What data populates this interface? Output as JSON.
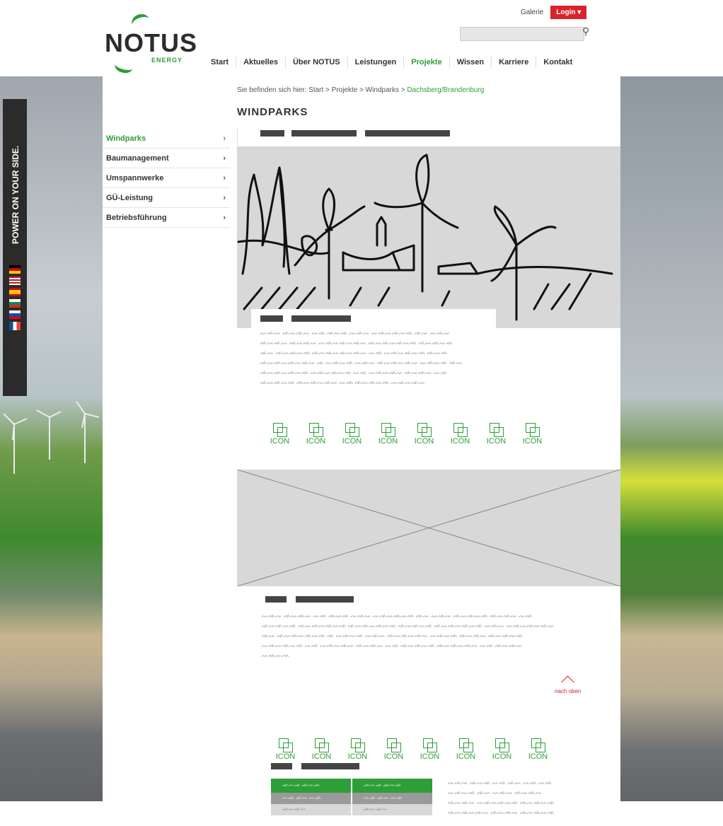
{
  "header": {
    "logo": {
      "word": "NOTUS",
      "sub": "ENERGY"
    },
    "top_links": {
      "galerie": "Galerie",
      "login": "Login ▾"
    },
    "search": {
      "placeholder": ""
    },
    "nav": [
      "Start",
      "Aktuelles",
      "Über NOTUS",
      "Leistungen",
      "Projekte",
      "Wissen",
      "Karriere",
      "Kontakt"
    ],
    "active_nav": "Projekte"
  },
  "sidebar_banner": {
    "text": "POWER ON YOUR SIDE."
  },
  "breadcrumb": {
    "prefix": "Sie befinden sich hier: Start > Projekte > Windparks > ",
    "current": "Dachsberg/Brandenburg"
  },
  "page_title": "WINDPARKS",
  "sidenav": [
    {
      "label": "Windparks",
      "active": true
    },
    {
      "label": "Baumanagement",
      "active": false
    },
    {
      "label": "Umspannwerke",
      "active": false
    },
    {
      "label": "GÜ-Leistung",
      "active": false
    },
    {
      "label": "Betriebsführung",
      "active": false
    }
  ],
  "section1": {
    "text_lines": [
      "ᨓᨒᨓ ᨒᨓᨒᨓ ᨓᨒ ᨒᨓᨒ ᨓᨒᨓ ᨓᨒᨓᨒᨓᨒ ᨒᨓ ᨓᨒᨓ",
      "ᨒᨓᨒᨓ ᨒᨓᨒᨓ ᨓᨒᨓᨒᨓᨒᨓ ᨒᨓᨒᨓᨒᨓᨒ ᨒᨓᨒᨓᨒ",
      "ᨒᨓ ᨒᨓᨒᨓᨒ ᨒᨓᨒᨓᨒᨓᨒᨓ ᨓᨒ ᨓᨒᨓᨒᨓᨒ ᨒᨓᨒ",
      "ᨒᨓᨒᨓᨒᨓᨒᨓ ᨒ ᨓᨒᨓᨒ ᨓᨒᨓ ᨒᨓᨒᨓᨒᨓ ᨓᨒᨓᨒ ᨒᨓ",
      "ᨒᨓᨒᨓᨒᨓᨒ ᨓᨒᨓᨒᨓᨒ ᨓᨒ ᨓᨒᨓᨒᨓ ᨒᨓᨒᨓ ᨓᨒ",
      "ᨒᨓᨒᨓᨒ ᨒᨓᨒᨓᨒᨓ ᨓᨒ ᨒᨓᨒᨓᨒ ᨓᨒᨓᨒᨓ"
    ]
  },
  "icons_row1": [
    "ICON",
    "ICON",
    "ICON",
    "ICON",
    "ICON",
    "ICON",
    "ICON",
    "ICON"
  ],
  "section2": {
    "text_lines": [
      "ᨓᨒᨓ ᨒᨓᨒᨓ ᨓᨒ ᨒᨓᨒ ᨓᨒᨓ ᨓᨒᨓᨒᨓᨒ ᨒᨓ ᨓᨒᨓ ᨒᨓᨒᨓᨒ ᨒᨓᨒᨓ ᨓᨒ",
      "ᨒᨓᨒᨓᨒ ᨒᨓᨒᨓᨒᨓᨒ ᨒᨓᨒᨓᨒᨓᨒ ᨒᨓᨒᨓᨒ ᨒᨓᨒᨓᨒᨓᨒ ᨓᨒᨓ ᨓᨒᨓᨒᨓᨒᨓ",
      "ᨒᨓ ᨒᨓᨒᨓᨒᨓᨒ ᨒ ᨓᨒᨓᨒ ᨓᨒᨓ ᨒᨓᨒᨓᨒᨓ ᨓᨒᨓᨒ ᨒᨓᨒᨓ ᨒᨓᨒᨓᨒ",
      "ᨓᨒᨓᨒᨓᨒ ᨓᨒ ᨓᨒᨓᨒᨓ ᨒᨓᨒᨓ ᨓᨒ ᨒᨓᨒᨓᨒ ᨒᨓᨒᨓᨒᨓ ᨓᨒ ᨒᨓᨒᨓ",
      "ᨓᨒᨓᨒ"
    ]
  },
  "nach_oben": "nach oben",
  "icons_row2": [
    "ICON",
    "ICON",
    "ICON",
    "ICON",
    "ICON",
    "ICON",
    "ICON",
    "ICON"
  ],
  "table": {
    "head": [
      "ᨒᨓᨒ ᨒᨓᨒ",
      "ᨒᨓᨒ ᨒᨓᨒ"
    ],
    "row1": [
      "ᨓᨒ ᨒᨓ ᨓᨒ",
      "ᨓᨒ ᨒᨓ ᨓᨒ"
    ],
    "row2": [
      "ᨒᨓᨒᨓ",
      "ᨒᨓᨒᨓ"
    ]
  },
  "side_text_lines": [
    "ᨓᨒᨓ ᨒᨓᨒ ᨓᨒ ᨒᨓ ᨓᨒ ᨓᨒ",
    "ᨓᨒᨓᨒ ᨒᨓ ᨓᨒᨓ ᨒᨓᨒᨓ",
    "ᨒᨓᨒᨓ ᨓᨒᨓᨒᨓᨒ ᨒᨓᨒᨓᨒ",
    "ᨒᨓᨒᨓᨒᨓ ᨒᨓᨒᨓ ᨒᨓᨒᨓᨒ"
  ],
  "colors": {
    "brand_green": "#2e9e36",
    "accent_red": "#d8232a"
  }
}
